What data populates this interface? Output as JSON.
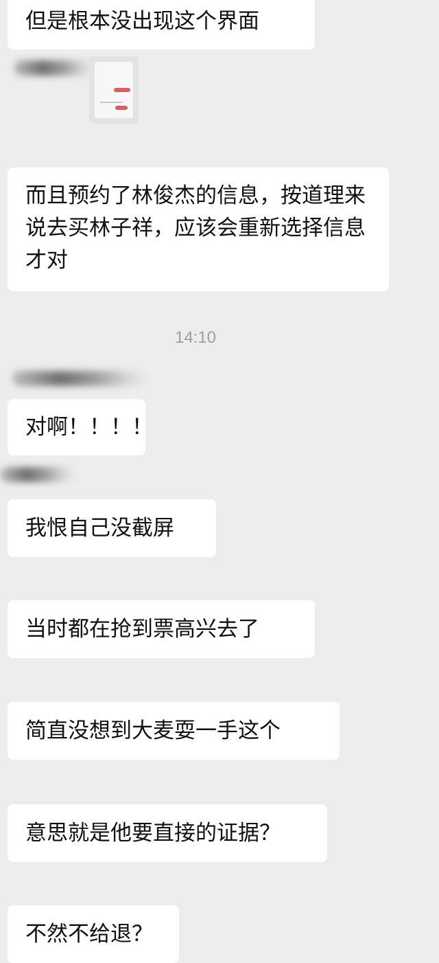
{
  "messages": [
    {
      "text": "但是根本没出现这个界面"
    },
    {
      "text": "而且预约了林俊杰的信息，按道理来说去买林子祥，应该会重新选择信息才对"
    },
    {
      "text": "对啊！！！！"
    },
    {
      "text": "我恨自己没截屏"
    },
    {
      "text": "当时都在抢到票高兴去了"
    },
    {
      "text": "简直没想到大麦耍一手这个"
    },
    {
      "text": "意思就是他要直接的证据？"
    },
    {
      "text": "不然不给退？"
    }
  ],
  "timestamp": "14:10",
  "icons": {
    "screenshot_thumbnail": "screenshot-thumbnail"
  },
  "colors": {
    "background": "#ededed",
    "bubble": "#ffffff",
    "text": "#111111",
    "timestamp": "#9d9d9d",
    "thumbnail_accent": "#e05a5a"
  }
}
